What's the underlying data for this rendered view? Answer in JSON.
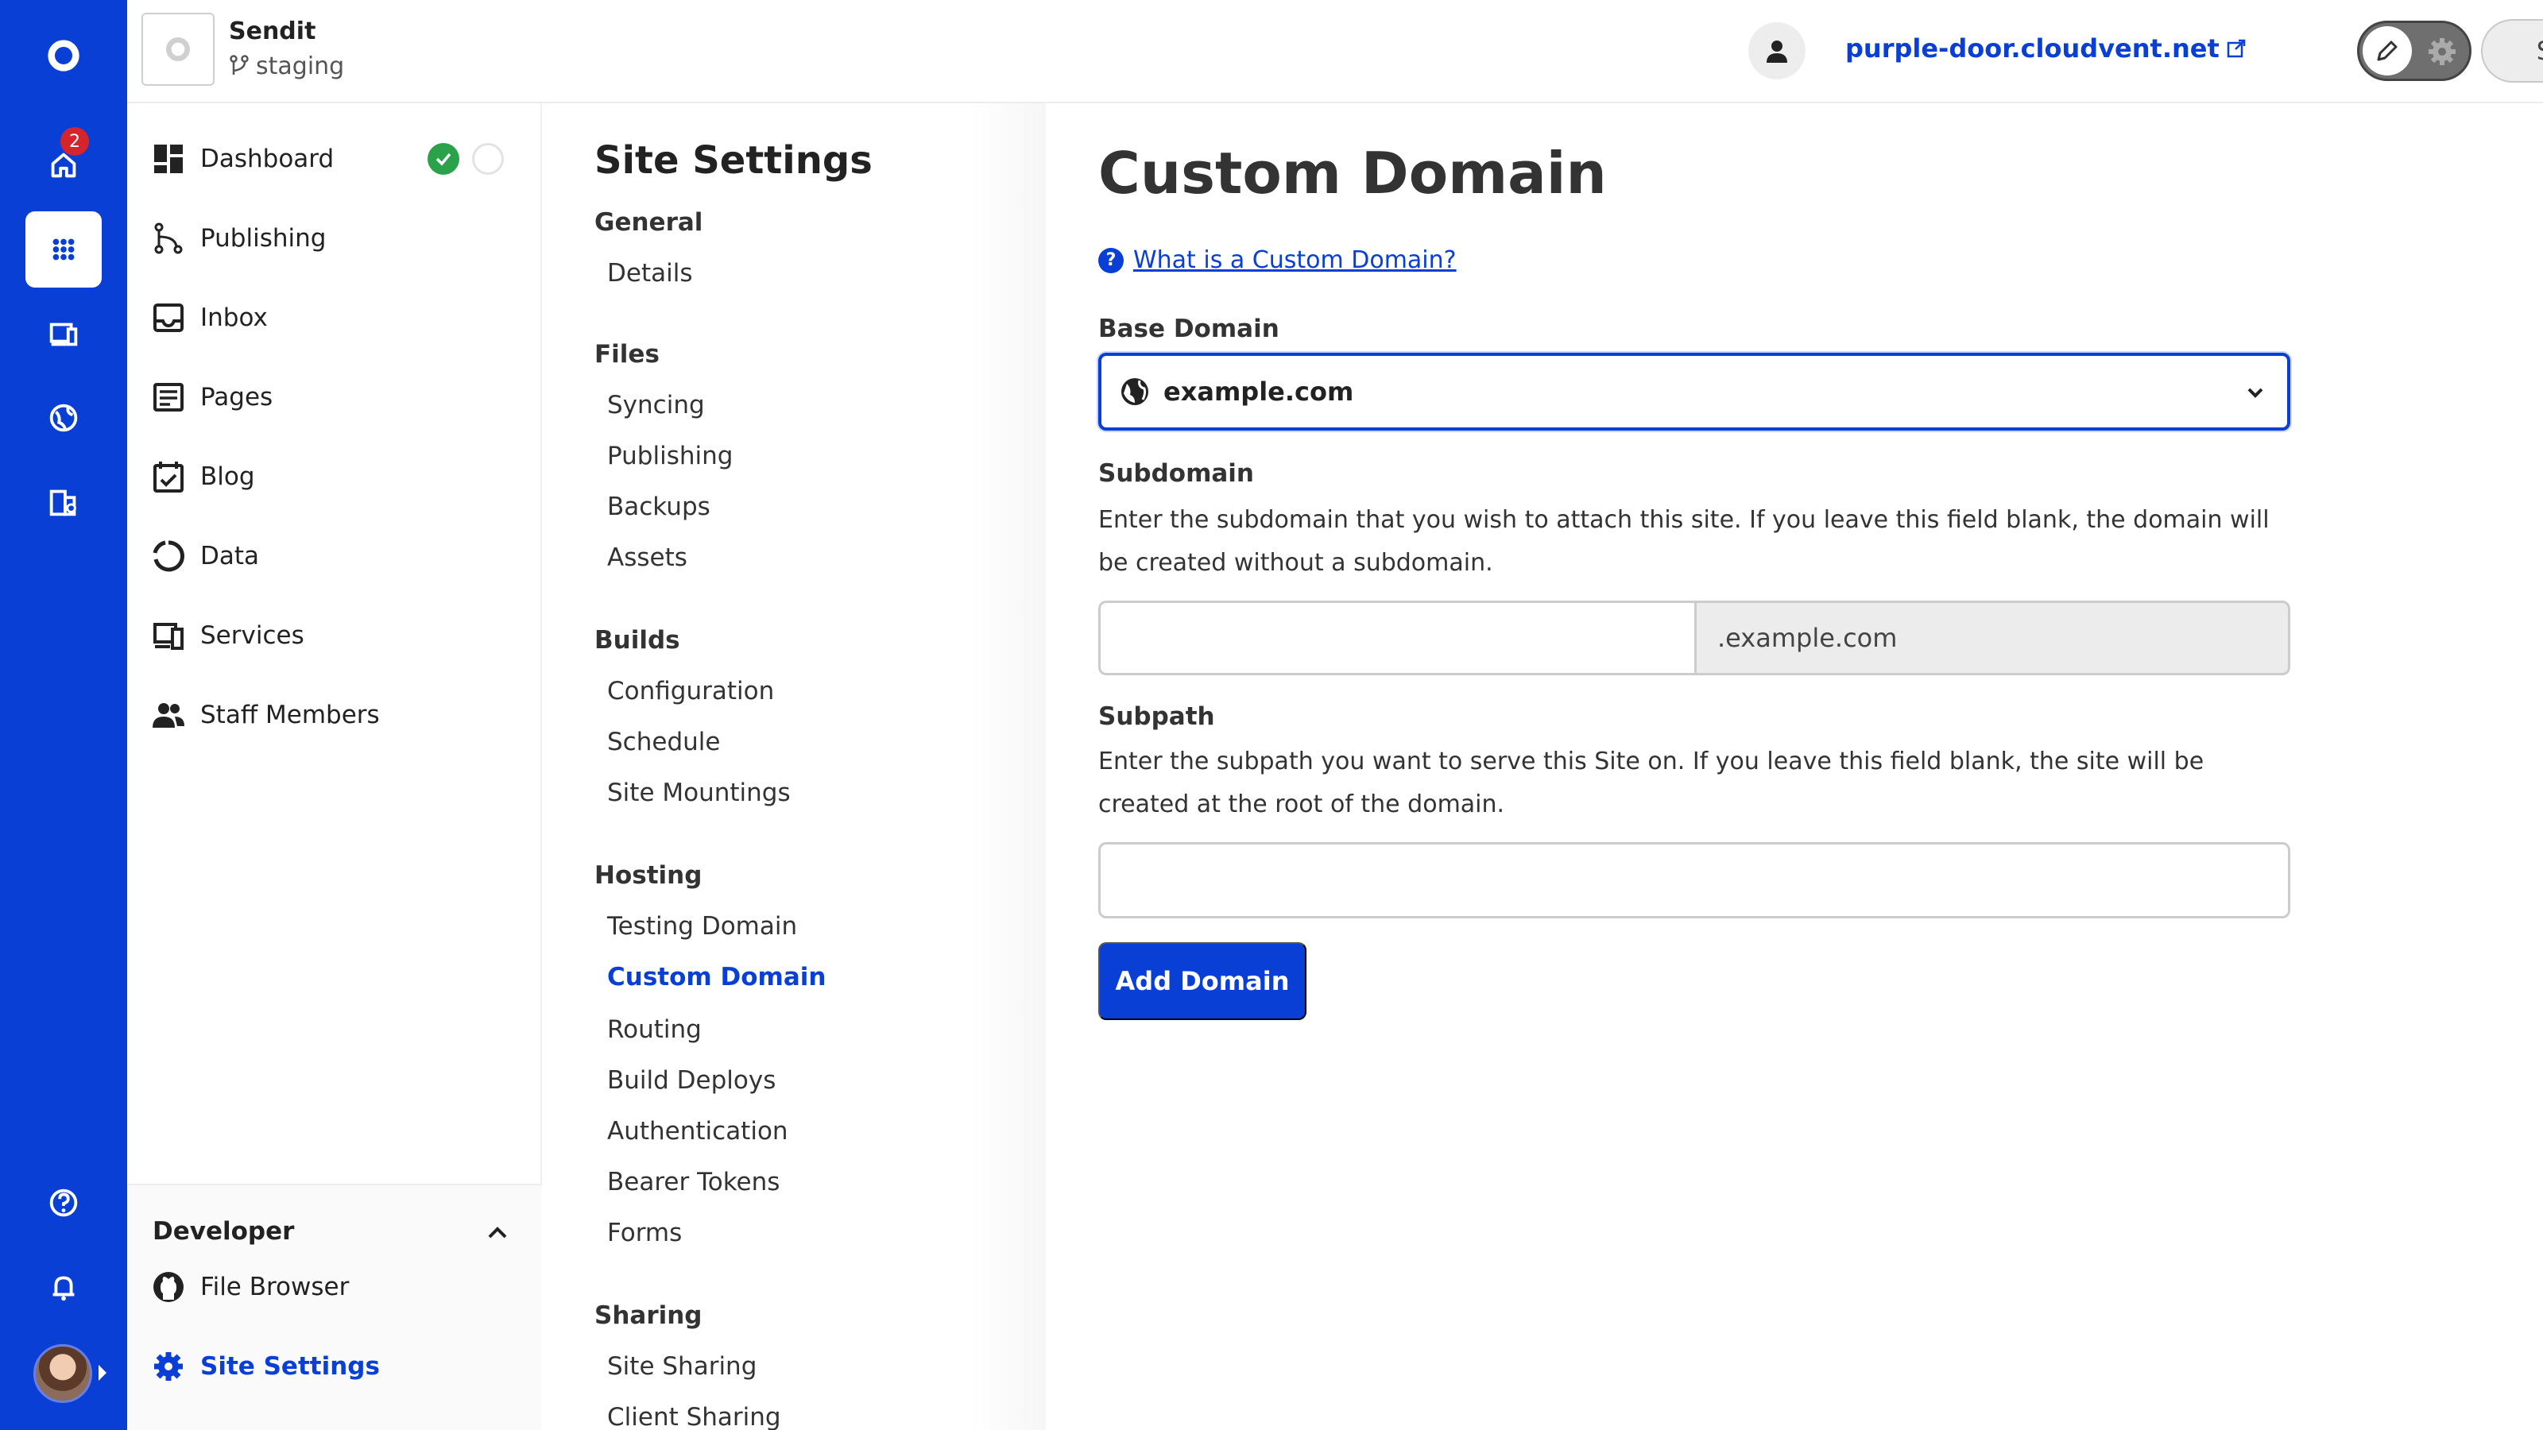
{
  "rail": {
    "home_badge": "2"
  },
  "topbar": {
    "site_name": "Sendit",
    "branch": "staging",
    "domain": "purple-door.cloudvent.net",
    "save_label": "Save"
  },
  "mainnav": {
    "items": [
      {
        "label": "Dashboard",
        "icon": "dashboard-icon"
      },
      {
        "label": "Publishing",
        "icon": "publishing-icon"
      },
      {
        "label": "Inbox",
        "icon": "inbox-icon"
      },
      {
        "label": "Pages",
        "icon": "pages-icon"
      },
      {
        "label": "Blog",
        "icon": "blog-icon"
      },
      {
        "label": "Data",
        "icon": "data-icon"
      },
      {
        "label": "Services",
        "icon": "services-icon"
      },
      {
        "label": "Staff Members",
        "icon": "staff-icon"
      }
    ],
    "developer": {
      "title": "Developer",
      "items": [
        {
          "label": "File Browser",
          "icon": "github-icon"
        },
        {
          "label": "Site Settings",
          "icon": "gear-icon",
          "active": true
        }
      ]
    }
  },
  "settings": {
    "title": "Site Settings",
    "groups": [
      {
        "label": "General",
        "links": [
          "Details"
        ]
      },
      {
        "label": "Files",
        "links": [
          "Syncing",
          "Publishing",
          "Backups",
          "Assets"
        ]
      },
      {
        "label": "Builds",
        "links": [
          "Configuration",
          "Schedule",
          "Site Mountings"
        ]
      },
      {
        "label": "Hosting",
        "links": [
          "Testing Domain",
          "Custom Domain",
          "Routing",
          "Build Deploys",
          "Authentication",
          "Bearer Tokens",
          "Forms"
        ]
      },
      {
        "label": "Sharing",
        "links": [
          "Site Sharing",
          "Client Sharing"
        ]
      }
    ],
    "active_link": "Custom Domain"
  },
  "content": {
    "title": "Custom Domain",
    "help_link": "What is a Custom Domain?",
    "base_domain_label": "Base Domain",
    "base_domain_value": "example.com",
    "subdomain_label": "Subdomain",
    "subdomain_help": "Enter the subdomain that you wish to attach this site. If you leave this field blank, the domain will be created without a subdomain.",
    "subdomain_suffix": ".example.com",
    "subdomain_value": "",
    "subpath_label": "Subpath",
    "subpath_help": "Enter the subpath you want to serve this Site on. If you leave this field blank, the site will be created at the root of the domain.",
    "subpath_value": "",
    "add_button": "Add Domain"
  },
  "colors": {
    "brand": "#0a3fd6",
    "success": "#2aa24a",
    "badge": "#d4252d"
  }
}
